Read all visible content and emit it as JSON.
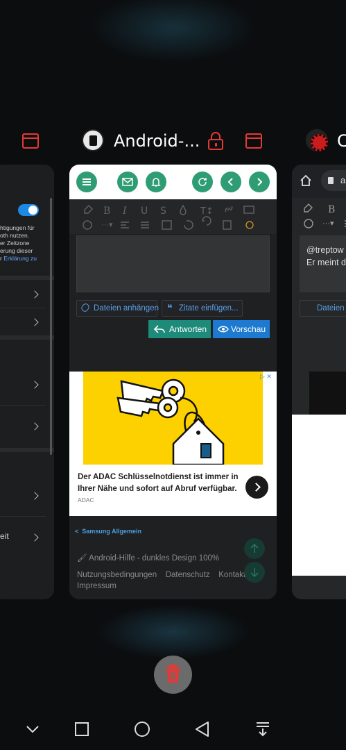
{
  "header": {
    "center_app_title": "Android-...",
    "right_app_title": "C"
  },
  "left_card": {
    "lines": [
      "htigungen für",
      "oth nutzen.",
      "er Zeitzone",
      "erung dieser"
    ],
    "link_prefix": "r ",
    "link_text": "Erklärung zu",
    "last_item": "eit"
  },
  "mid_card": {
    "buttons": {
      "attach": "Dateien anhängen",
      "quotes": "Zitate einfügen...",
      "reply": "Antworten",
      "preview": "Vorschau"
    },
    "ad": {
      "text": "Der ADAC Schlüsselnotdienst ist immer in Ihrer Nähe und sofort auf Abruf verfügbar.",
      "brand": "ADAC"
    },
    "breadcrumb": "Samsung Allgemein",
    "footer": {
      "style_label": "Android-Hilfe - dunkles Design 100%",
      "links": [
        "Nutzungsbedingungen",
        "Datenschutz",
        "Kontakt"
      ],
      "impressum": "Impressum"
    }
  },
  "right_card": {
    "url_text": "a",
    "content_lines": [
      "@treptow",
      "Er meint d"
    ],
    "attach_button": "Dateien a"
  },
  "colors": {
    "accent_red": "#e53935",
    "green": "#2f9d74",
    "blue": "#1e7ad1",
    "ad_yellow": "#fdd000"
  }
}
